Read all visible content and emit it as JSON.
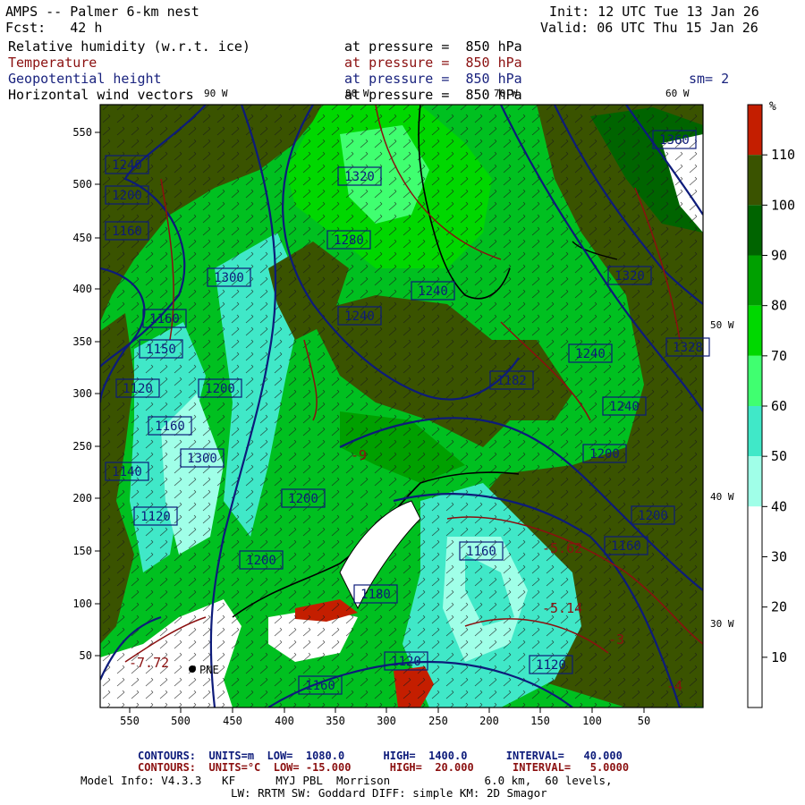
{
  "header": {
    "model": "AMPS -- Palmer 6-km nest",
    "fcst": "Fcst:   42 h",
    "init": "Init: 12 UTC Tue 13 Jan 26",
    "valid": "Valid: 06 UTC Thu 15 Jan 26",
    "fields": [
      {
        "name": "Relative humidity (w.r.t. ice)",
        "level": "at pressure =  850 hPa",
        "color": "#000000"
      },
      {
        "name": "Temperature",
        "level": "at pressure =  850 hPa",
        "color": "#8b1010"
      },
      {
        "name": "Geopotential height",
        "level": "at pressure =  850 hPa",
        "color": "#1a237e"
      },
      {
        "name": "Horizontal wind vectors",
        "level": "at pressure =  850 hPa",
        "color": "#000000"
      }
    ],
    "smoothing": "sm= 2"
  },
  "map": {
    "x_ticks": [
      "550",
      "500",
      "450",
      "400",
      "350",
      "300",
      "250",
      "200",
      "150",
      "100",
      "50"
    ],
    "y_ticks": [
      "550",
      "500",
      "450",
      "400",
      "350",
      "300",
      "250",
      "200",
      "150",
      "100",
      "50"
    ],
    "lon_labels_top": [
      "90 W",
      "80 W",
      "70 W",
      "60 W"
    ],
    "lon_labels_right": [
      "50 W",
      "40 W",
      "30 W"
    ],
    "station": "PNE",
    "height_labels": [
      "1240",
      "1200",
      "1160",
      "1300",
      "1160",
      "1150",
      "1120",
      "1200",
      "1160",
      "1300",
      "1140",
      "1120",
      "1200",
      "1200",
      "1280",
      "1240",
      "1240",
      "1320",
      "1360",
      "1320",
      "1328",
      "1240",
      "1182",
      "1240",
      "1200",
      "1200",
      "1160",
      "1180",
      "1120",
      "1160",
      "1120",
      "1160"
    ],
    "temp_labels": [
      "-5.62",
      "-5.14",
      "-7.72",
      "-9",
      "-4",
      "-3"
    ],
    "colors": {
      "rh_110": "#c41e00",
      "rh_100": "#3a5300",
      "rh_90": "#006400",
      "rh_80": "#00a000",
      "rh_70": "#00d800",
      "rh_60": "#40ff70",
      "rh_50": "#40e8c8",
      "rh_40": "#a0ffe8",
      "rh_30": "#ffffff",
      "height_contour": "#0d1b7a",
      "temp_contour": "#8b1010"
    }
  },
  "colorbar": {
    "unit": "%",
    "labels": [
      "110",
      "100",
      "90",
      "80",
      "70",
      "60",
      "50",
      "40",
      "30",
      "20",
      "10"
    ]
  },
  "footer": {
    "contour1": "CONTOURS:  UNITS=m  LOW=  1080.0      HIGH=  1400.0      INTERVAL=   40.000",
    "contour2": "CONTOURS:  UNITS=°C  LOW= -15.000      HIGH=  20.000      INTERVAL=   5.0000",
    "model_info": "Model Info: V4.3.3   KF      MYJ PBL  Morrison              6.0 km,  60 levels,",
    "model_info2": "LW: RRTM SW: Goddard DIFF: simple KM: 2D Smagor"
  }
}
